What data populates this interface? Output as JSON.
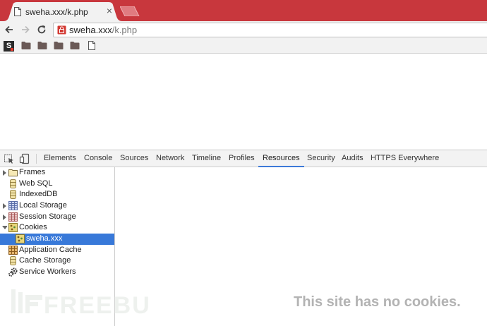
{
  "browser": {
    "tab": {
      "title": "sweha.xxx/k.php",
      "close_glyph": "×",
      "favicon": "page-icon"
    },
    "omnibox": {
      "host": "sweha.xxx",
      "path": "/k.php",
      "security_icon": "broken-lock-icon"
    },
    "nav": [
      "back-arrow-icon",
      "forward-arrow-icon",
      "reload-icon"
    ],
    "bookmarks": [
      {
        "icon": "s-logo-icon",
        "glyph": "S"
      },
      {
        "icon": "folder-icon"
      },
      {
        "icon": "folder-icon"
      },
      {
        "icon": "folder-icon"
      },
      {
        "icon": "folder-icon"
      },
      {
        "icon": "page-icon"
      }
    ]
  },
  "devtools": {
    "toolbar_icons": [
      "inspect-element-icon",
      "device-mode-icon"
    ],
    "tabs": [
      {
        "label": "Elements"
      },
      {
        "label": "Console"
      },
      {
        "label": "Sources"
      },
      {
        "label": "Network"
      },
      {
        "label": "Timeline"
      },
      {
        "label": "Profiles"
      },
      {
        "label": "Resources",
        "active": true
      },
      {
        "label": "Security"
      },
      {
        "label": "Audits"
      },
      {
        "label": "HTTPS Everywhere"
      }
    ],
    "sidebar": [
      {
        "label": "Frames",
        "icon": "folder-icon",
        "expander": "collapsed"
      },
      {
        "label": "Web SQL",
        "icon": "database-icon"
      },
      {
        "label": "IndexedDB",
        "icon": "database-icon"
      },
      {
        "label": "Local Storage",
        "icon": "table-icon",
        "expander": "collapsed"
      },
      {
        "label": "Session Storage",
        "icon": "table-icon",
        "expander": "collapsed"
      },
      {
        "label": "Cookies",
        "icon": "cookie-icon",
        "expander": "expanded"
      },
      {
        "label": "sweha.xxx",
        "icon": "cookie-icon",
        "selected": true,
        "indent": 1
      },
      {
        "label": "Application Cache",
        "icon": "grid-icon"
      },
      {
        "label": "Cache Storage",
        "icon": "database-icon"
      },
      {
        "label": "Service Workers",
        "icon": "gears-icon"
      }
    ],
    "empty_message": "This site has no cookies."
  },
  "colors": {
    "titlebar": "#c8373d",
    "selection": "#3879d9",
    "active_tab_underline": "#3d7ad8",
    "empty_text": "#b3b3b3"
  },
  "watermark": {
    "text": "FREEBUF"
  }
}
